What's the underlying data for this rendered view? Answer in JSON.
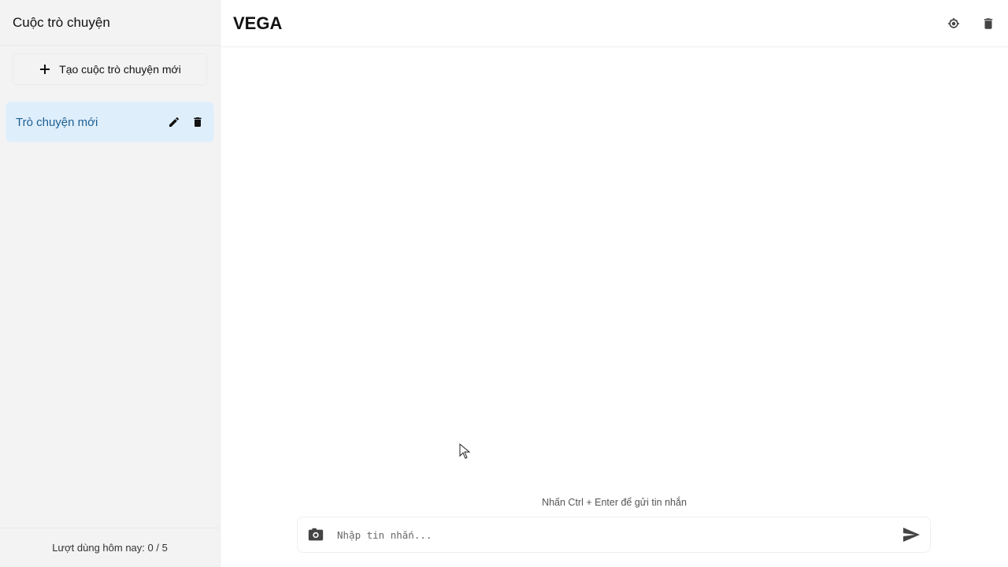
{
  "sidebar": {
    "title": "Cuộc trò chuyện",
    "new_chat_label": "Tạo cuộc trò chuyện mới",
    "conversations": [
      {
        "label": "Trò chuyện mới",
        "active": true
      }
    ],
    "usage_text": "Lượt dùng hôm nay: 0 / 5"
  },
  "header": {
    "title": "VEGA"
  },
  "composer": {
    "hint": "Nhấn Ctrl + Enter để gửi tin nhắn",
    "placeholder": "Nhập tin nhắn..."
  },
  "icons": {
    "new_chat": "plus-icon",
    "edit": "pencil-icon",
    "delete": "trash-icon",
    "header_settings": "settings-icon",
    "header_delete": "trash-icon",
    "attach": "image-icon",
    "send": "send-icon"
  },
  "colors": {
    "sidebar_bg": "#f3f3f3",
    "active_item_bg": "#dfeefb",
    "active_item_text": "#1d5f92"
  }
}
